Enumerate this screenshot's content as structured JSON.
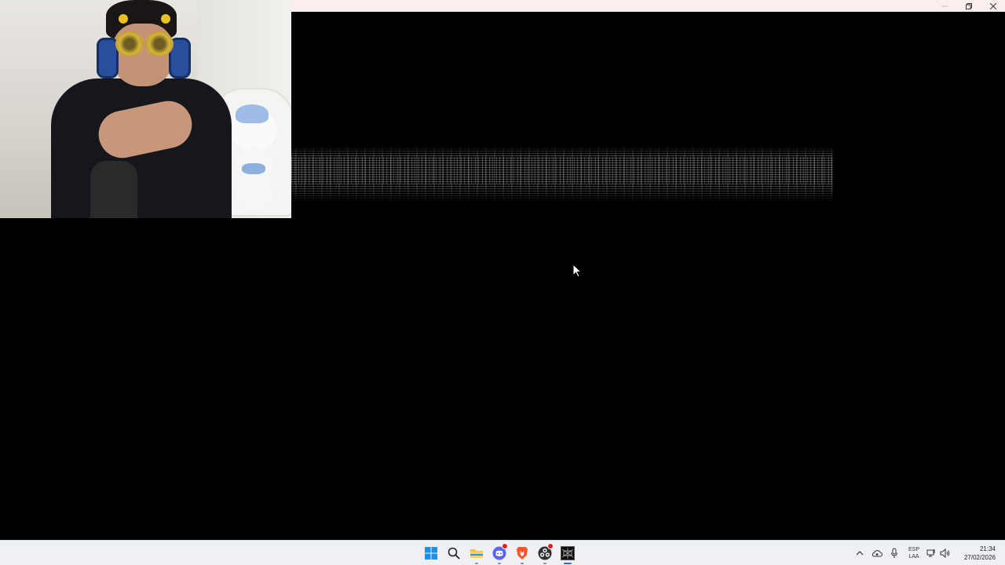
{
  "window": {
    "controls": {
      "minimize": "—",
      "restore": "❐",
      "close": "✕"
    }
  },
  "webcam": {
    "icon": "webcam-overlay"
  },
  "taskbar": {
    "apps": [
      {
        "name": "start",
        "icon": "windows-start-icon"
      },
      {
        "name": "search",
        "icon": "search-icon"
      },
      {
        "name": "file-explorer",
        "icon": "folder-icon"
      },
      {
        "name": "discord",
        "icon": "discord-icon",
        "badge": true
      },
      {
        "name": "brave",
        "icon": "brave-browser-icon"
      },
      {
        "name": "obs",
        "icon": "obs-icon",
        "badge": true
      },
      {
        "name": "game",
        "icon": "game-app-icon",
        "active": true
      }
    ],
    "tray": {
      "lang_line1": "ESP",
      "lang_line2": "LAA",
      "time": "21:34",
      "date": "27/02/2026"
    }
  },
  "colors": {
    "titlebar": "#fbeeee",
    "taskbar": "#eef0f5",
    "accent": "#2a6fd6"
  }
}
